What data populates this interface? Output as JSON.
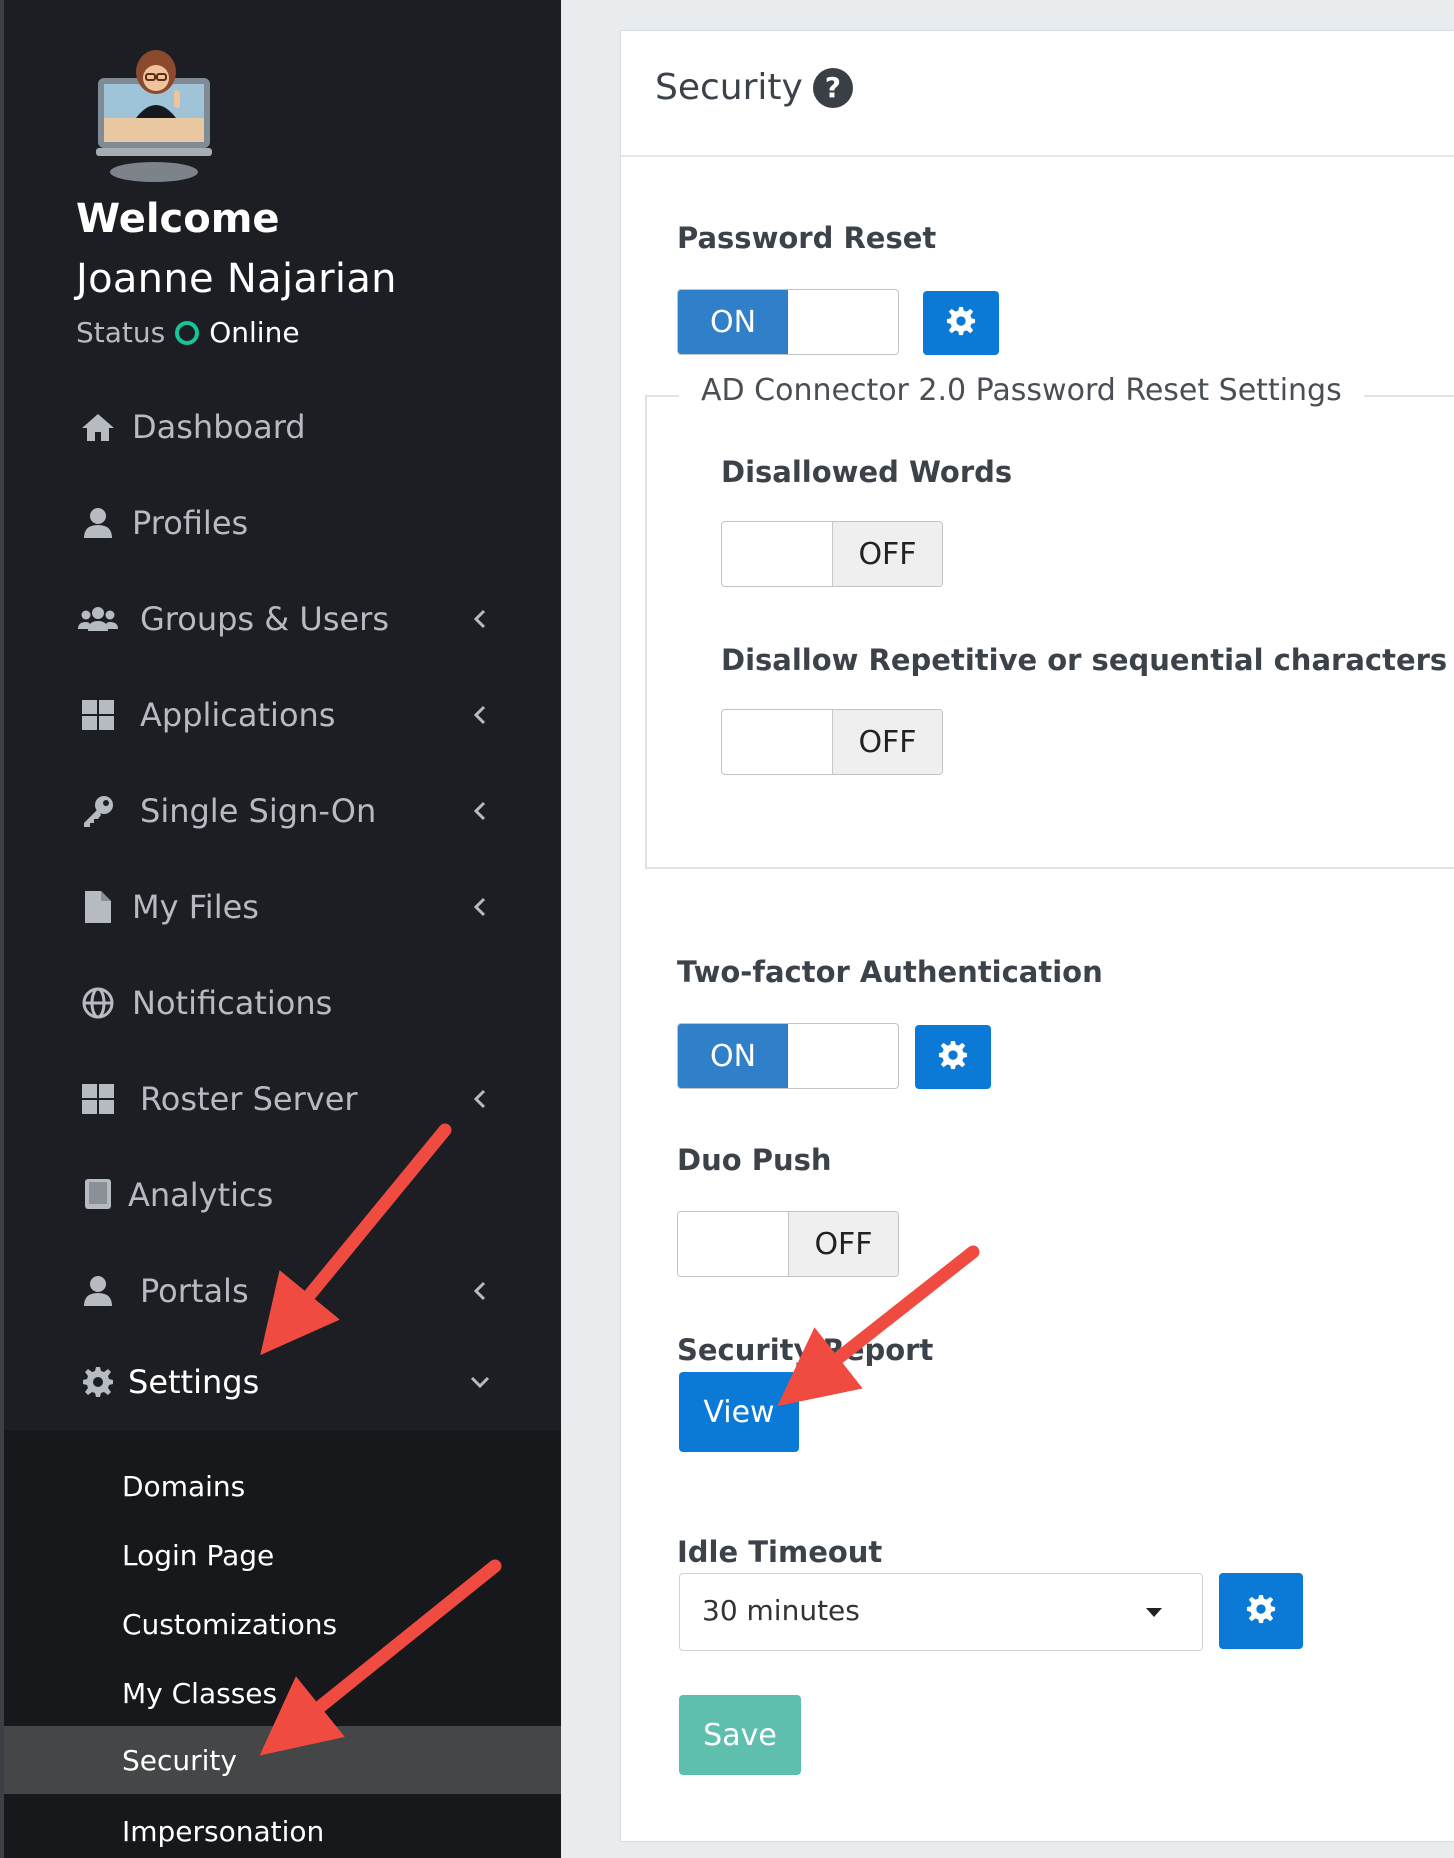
{
  "sidebar": {
    "welcome": "Welcome",
    "user_name": "Joanne Najarian",
    "status_label": "Status",
    "status_value": "Online",
    "status_color": "#18c39a",
    "nav": [
      {
        "label": "Dashboard",
        "icon": "home-icon",
        "has_submenu": false
      },
      {
        "label": "Profiles",
        "icon": "user-icon",
        "has_submenu": false
      },
      {
        "label": "Groups & Users",
        "icon": "users-icon",
        "has_submenu": true
      },
      {
        "label": "Applications",
        "icon": "grid-icon",
        "has_submenu": true
      },
      {
        "label": "Single Sign-On",
        "icon": "key-icon",
        "has_submenu": true
      },
      {
        "label": "My Files",
        "icon": "file-icon",
        "has_submenu": true
      },
      {
        "label": "Notifications",
        "icon": "globe-icon",
        "has_submenu": false
      },
      {
        "label": "Roster Server",
        "icon": "grid-icon",
        "has_submenu": true
      },
      {
        "label": "Analytics",
        "icon": "book-icon",
        "has_submenu": false
      },
      {
        "label": "Portals",
        "icon": "user-icon",
        "has_submenu": true
      },
      {
        "label": "Settings",
        "icon": "gear-icon",
        "has_submenu": true,
        "expanded": true
      }
    ],
    "settings_submenu": [
      "Domains",
      "Login Page",
      "Customizations",
      "My Classes",
      "Security",
      "Impersonation"
    ],
    "active_submenu": "Security"
  },
  "security": {
    "title": "Security",
    "password_reset": {
      "label": "Password Reset",
      "state": "ON"
    },
    "ad_connector": {
      "legend": "AD Connector 2.0 Password Reset Settings",
      "disallowed_words": {
        "label": "Disallowed Words",
        "state": "OFF"
      },
      "disallow_repetitive": {
        "label": "Disallow Repetitive or sequential characters",
        "state": "OFF"
      }
    },
    "two_factor": {
      "label": "Two-factor Authentication",
      "state": "ON"
    },
    "duo_push": {
      "label": "Duo Push",
      "state": "OFF"
    },
    "security_report": {
      "label": "Security Report",
      "button": "View"
    },
    "idle_timeout": {
      "label": "Idle Timeout",
      "value": "30 minutes"
    },
    "save_button": "Save"
  },
  "colors": {
    "sidebar_bg": "#1c1e23",
    "primary": "#0a7ad6",
    "toggle_on": "#2f80c8",
    "save": "#5ebfae",
    "annotation_arrow": "#f04b40"
  }
}
